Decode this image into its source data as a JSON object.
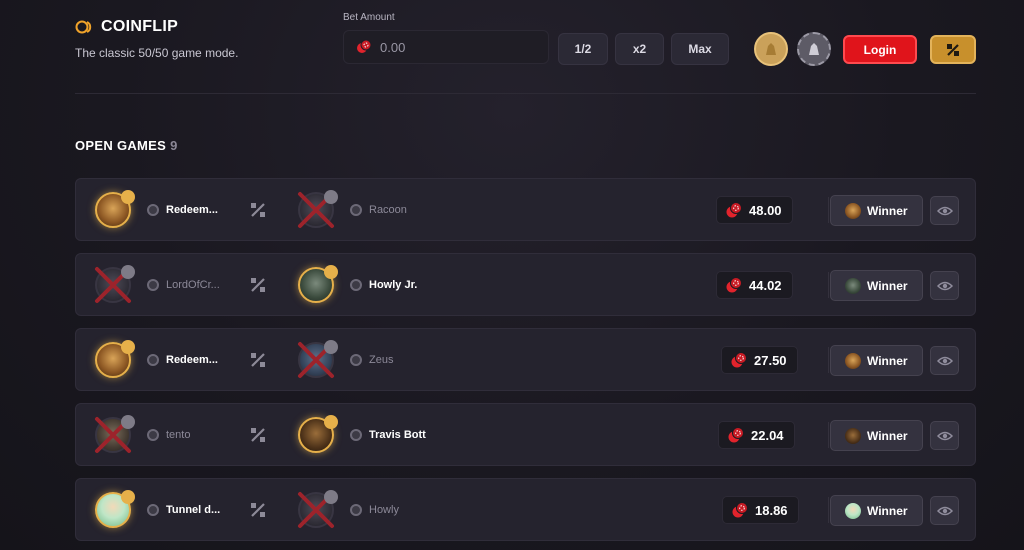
{
  "brand": {
    "title": "COINFLIP",
    "subtitle": "The classic 50/50 game mode."
  },
  "bet": {
    "label": "Bet Amount",
    "value": "0.00",
    "half": "1/2",
    "double": "x2",
    "max": "Max"
  },
  "auth": {
    "login": "Login"
  },
  "open_games": {
    "title": "OPEN GAMES",
    "count": "9"
  },
  "winner_label": "Winner",
  "colors": {
    "accent_gold": "#e6b04a",
    "login_red": "#e0141b",
    "chip_red": "#e2232c"
  },
  "games": [
    {
      "left_name": "Redeem...",
      "left_state": "win",
      "right_name": "Racoon",
      "right_state": "lose",
      "amount": "48.00",
      "left_avatar": "lion",
      "right_avatar": "dark"
    },
    {
      "left_name": "LordOfCr...",
      "left_state": "lose",
      "right_name": "Howly Jr.",
      "right_state": "win",
      "amount": "44.02",
      "left_avatar": "dark",
      "right_avatar": "green"
    },
    {
      "left_name": "Redeem...",
      "left_state": "win",
      "right_name": "Zeus",
      "right_state": "lose",
      "amount": "27.50",
      "left_avatar": "lion",
      "right_avatar": "blue"
    },
    {
      "left_name": "tento",
      "left_state": "lose",
      "right_name": "Travis Bott",
      "right_state": "win",
      "amount": "22.04",
      "left_avatar": "tan",
      "right_avatar": "orange"
    },
    {
      "left_name": "Tunnel d...",
      "left_state": "win",
      "right_name": "Howly",
      "right_state": "lose",
      "amount": "18.86",
      "left_avatar": "person",
      "right_avatar": "dark"
    }
  ]
}
